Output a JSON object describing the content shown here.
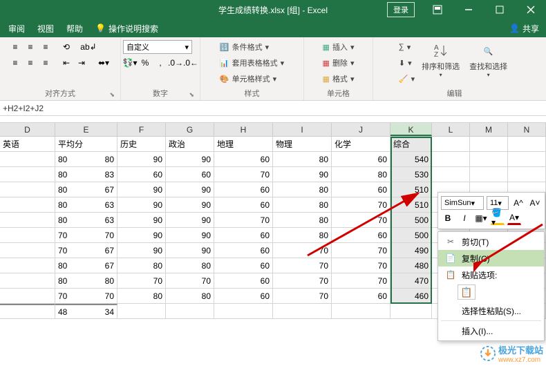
{
  "titlebar": {
    "title": "学生成绩转换.xlsx [组] - Excel",
    "login": "登录"
  },
  "menus": {
    "review": "审阅",
    "view": "视图",
    "help": "帮助",
    "tell_me": "操作说明搜索",
    "share": "共享"
  },
  "ribbon": {
    "alignment": {
      "label": "对齐方式"
    },
    "number": {
      "label": "数字",
      "format": "自定义"
    },
    "styles": {
      "label": "样式",
      "cond": "条件格式",
      "table": "套用表格格式",
      "cellstyle": "单元格样式"
    },
    "cells": {
      "label": "单元格",
      "insert": "插入",
      "delete": "删除",
      "format": "格式"
    },
    "editing": {
      "label": "编辑",
      "sort": "排序和筛选",
      "find": "查找和选择"
    }
  },
  "formula": "+H2+I2+J2",
  "columns": [
    "D",
    "E",
    "F",
    "G",
    "H",
    "I",
    "J",
    "K",
    "L",
    "M",
    "N"
  ],
  "headers": {
    "D": "英语",
    "E": "平均分",
    "F": "历史",
    "G": "政治",
    "H": "地理",
    "I": "物理",
    "J": "化学",
    "K": "综合"
  },
  "rows": [
    {
      "D": "",
      "E1": "80",
      "E2": "80",
      "F": "90",
      "G": "90",
      "H": "60",
      "I": "80",
      "J": "60",
      "K": "540"
    },
    {
      "D": "",
      "E1": "80",
      "E2": "83",
      "F": "60",
      "G": "60",
      "H": "70",
      "I": "90",
      "J": "80",
      "K": "530"
    },
    {
      "D": "",
      "E1": "80",
      "E2": "67",
      "F": "90",
      "G": "90",
      "H": "60",
      "I": "80",
      "J": "60",
      "K": "510"
    },
    {
      "D": "",
      "E1": "80",
      "E2": "63",
      "F": "90",
      "G": "90",
      "H": "60",
      "I": "80",
      "J": "70",
      "K": "510"
    },
    {
      "D": "",
      "E1": "80",
      "E2": "63",
      "F": "90",
      "G": "90",
      "H": "70",
      "I": "80",
      "J": "70",
      "K": "500"
    },
    {
      "D": "",
      "E1": "70",
      "E2": "70",
      "F": "90",
      "G": "90",
      "H": "60",
      "I": "80",
      "J": "60",
      "K": "500"
    },
    {
      "D": "",
      "E1": "70",
      "E2": "67",
      "F": "90",
      "G": "90",
      "H": "60",
      "I": "70",
      "J": "70",
      "K": "490"
    },
    {
      "D": "",
      "E1": "80",
      "E2": "67",
      "F": "80",
      "G": "80",
      "H": "60",
      "I": "70",
      "J": "70",
      "K": "480"
    },
    {
      "D": "",
      "E1": "80",
      "E2": "80",
      "F": "70",
      "G": "70",
      "H": "60",
      "I": "70",
      "J": "70",
      "K": "470"
    },
    {
      "D": "",
      "E1": "70",
      "E2": "70",
      "F": "80",
      "G": "80",
      "H": "60",
      "I": "70",
      "J": "60",
      "K": "460"
    },
    {
      "D": "",
      "E1": "48",
      "E2": "34",
      "F": "",
      "G": "",
      "H": "",
      "I": "",
      "J": "",
      "K": ""
    }
  ],
  "mini": {
    "font": "SimSun",
    "size": "11"
  },
  "context": {
    "cut": "剪切(T)",
    "copy": "复制(C)",
    "paste_opts": "粘贴选项:",
    "paste_special": "选择性粘贴(S)...",
    "insert": "插入(I)..."
  },
  "watermark": {
    "text": "极光下载站",
    "url": "www.xz7.com"
  }
}
